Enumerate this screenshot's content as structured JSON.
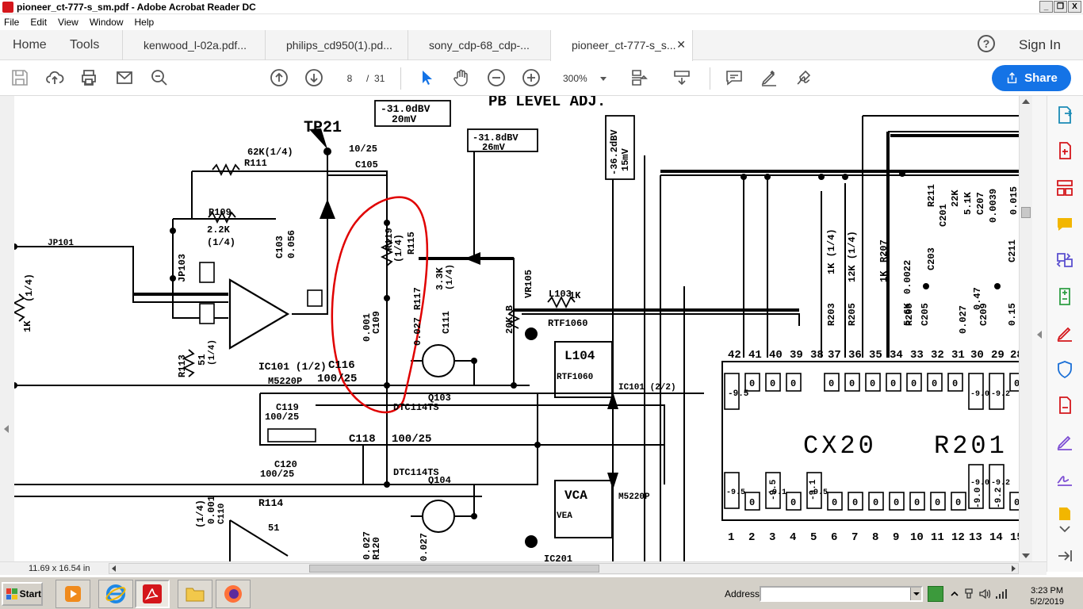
{
  "window": {
    "title": "pioneer_ct-777-s_sm.pdf - Adobe Acrobat Reader DC",
    "controls": [
      "_",
      "❐",
      "X"
    ]
  },
  "menu": [
    "File",
    "Edit",
    "View",
    "Window",
    "Help"
  ],
  "tabs": {
    "home": "Home",
    "tools": "Tools",
    "documents": [
      {
        "label": "kenwood_l-02a.pdf..."
      },
      {
        "label": "philips_cd950(1).pd..."
      },
      {
        "label": "sony_cdp-68_cdp-..."
      },
      {
        "label": "pioneer_ct-777-s_s...",
        "active": true
      }
    ],
    "close_symbol": "✕",
    "help_symbol": "?",
    "sign_in": "Sign In"
  },
  "toolbar": {
    "current_page": "8",
    "page_separator": "/",
    "total_pages": "31",
    "zoom": "300%",
    "share_label": "Share",
    "accent_color": "#1473e6"
  },
  "status": {
    "page_size": "11.69 x 16.54 in"
  },
  "schematic": {
    "header_text": "PB LEVEL ADJ.",
    "test_point": "TP21",
    "annotation_circle_color": "#e00000",
    "labels": [
      "-31.0dBV",
      "20mV",
      "-31.8dBV",
      "26mV",
      "-36.2dBV",
      "15mV",
      "62K(1/4)",
      "R111",
      "10/25",
      "C105",
      "R109",
      "2.2K",
      "(1/4)",
      "C103",
      "0.056",
      "JP101",
      "JP103",
      "1K",
      "(1/4)",
      "IC101 (1/2)",
      "M5220P",
      "R113",
      "51",
      "(1/4)",
      "C116",
      "100/25",
      "C119",
      "100/25",
      "C118",
      "100/25",
      "C120",
      "100/25",
      "DTC114TS",
      "DTC114TS",
      "Q103",
      "Q104",
      "R117",
      "3.3K",
      "(1/4)",
      "C111",
      "0.027",
      "C109",
      "0.001",
      "R115",
      "VR105",
      "20K-B",
      "R119",
      "1K",
      "(1/4)",
      "L103",
      "RTF1060",
      "L104",
      "RTF1060",
      "VCA",
      "VEA",
      "IC101 (2/2)",
      "M5220P",
      "R114",
      "51",
      "(1/4)",
      "0.001",
      "C110",
      "0.027",
      "R120",
      "IC201",
      "CX20",
      "R201",
      "R203",
      "R205",
      "R207",
      "R209",
      "R211",
      "C201",
      "C203",
      "C205",
      "C207",
      "C209",
      "C211",
      "0.0022",
      "0.0039",
      "0.015",
      "0.15",
      "0.47",
      "0.027",
      "1K (1/4)",
      "12K (1/4)",
      "22K",
      "1K",
      "5.6K",
      "5.1K",
      "-9.5",
      "-9.1",
      "-9.0",
      "-9.2"
    ],
    "pins_top": [
      "42",
      "41",
      "40",
      "39",
      "38",
      "37",
      "36",
      "35",
      "34",
      "33",
      "32",
      "31",
      "30",
      "29",
      "28"
    ],
    "pin_values_top": [
      "-9.5",
      "0",
      "0",
      "0",
      "0",
      "0",
      "0",
      "0",
      "0",
      "0",
      "0",
      "0",
      "-9.0",
      "-9.2",
      "0"
    ],
    "pins_bottom": [
      "1",
      "2",
      "3",
      "4",
      "5",
      "6",
      "7",
      "8",
      "9",
      "10",
      "11",
      "12",
      "13",
      "14",
      "15"
    ],
    "pin_values_bottom": [
      "-9.5",
      "0",
      "-9.1",
      "0",
      "-9.5",
      "0",
      "0",
      "0",
      "0",
      "0",
      "0",
      "0",
      "-9.0",
      "-9.2",
      "0"
    ]
  },
  "taskbar": {
    "start_label": "Start",
    "address_label": "Address",
    "address_value": "",
    "time": "3:23 PM",
    "date": "5/2/2019"
  }
}
